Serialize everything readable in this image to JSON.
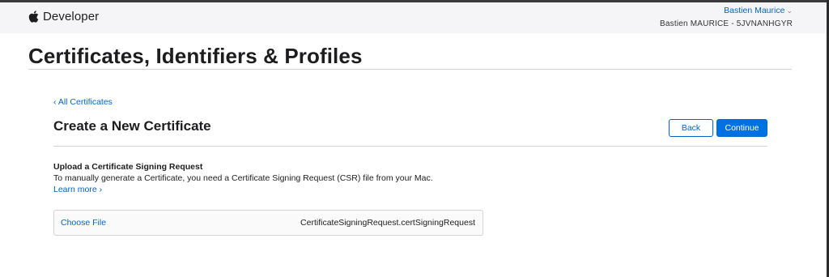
{
  "header": {
    "brand": "Developer",
    "user_name": "Bastien Maurice",
    "user_chevron": "⌄",
    "team": "Bastien MAURICE - 5JVNANHGYR"
  },
  "page": {
    "title": "Certificates, Identifiers & Profiles"
  },
  "main": {
    "back_link": "‹ All Certificates",
    "section_title": "Create a New Certificate",
    "back_button": "Back",
    "continue_button": "Continue",
    "upload_heading": "Upload a Certificate Signing Request",
    "upload_description": "To manually generate a Certificate, you need a Certificate Signing Request (CSR) file from your Mac.",
    "learn_more": "Learn more ›",
    "choose_file": "Choose File",
    "selected_file": "CertificateSigningRequest.certSigningRequest"
  },
  "icons": {
    "brand": "apple-icon"
  },
  "colors": {
    "link": "#0066cc",
    "primary_button": "#0071e3",
    "header_bg": "#f5f5f7"
  }
}
